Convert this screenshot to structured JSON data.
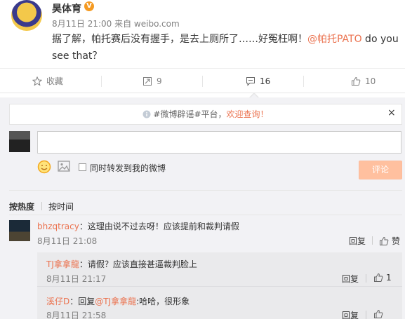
{
  "post": {
    "author": "昊体育",
    "verified_badge": "V",
    "meta": "8月11日 21:00 来自 weibo.com",
    "body_text": "据了解，帕托赛后没有握手，是去上厕所了……好冤枉啊！",
    "mention": "@帕托PATO",
    "body_tail": " do you see that？"
  },
  "actions": {
    "favorite_label": "收藏",
    "forward_count": "9",
    "comment_count": "16",
    "like_count": "10"
  },
  "compose": {
    "notice_prefix": "#微博辟谣#平台，",
    "notice_link": "欢迎查询！",
    "close_symbol": "×",
    "input_value": "",
    "forward_label": "同时转发到我的微博",
    "submit_label": "评论"
  },
  "sort": {
    "hot_label": "按热度",
    "time_label": "按时间"
  },
  "comments": [
    {
      "user": "bhzqtracy",
      "text": "：这理由说不过去呀！应该提前和裁判请假",
      "time": "8月11日 21:08",
      "reply_label": "回复",
      "like_label": "赞"
    }
  ],
  "replies": [
    {
      "user": "TJ拿拿龍",
      "text": "：请假？应该直接甚逼裁判脸上",
      "time": "8月11日 21:17",
      "reply_label": "回复",
      "like_count": "1"
    },
    {
      "user": "溪仔D",
      "text_prefix": "：回复",
      "mention": "@TJ拿拿龍",
      "text": ":哈哈，很形象",
      "time": "8月11日 21:58",
      "reply_label": "回复"
    }
  ],
  "colors": {
    "accent": "#eb7350",
    "muted": "#808080",
    "panel": "#f2f2f5",
    "submit_bg": "#ffc09f"
  }
}
